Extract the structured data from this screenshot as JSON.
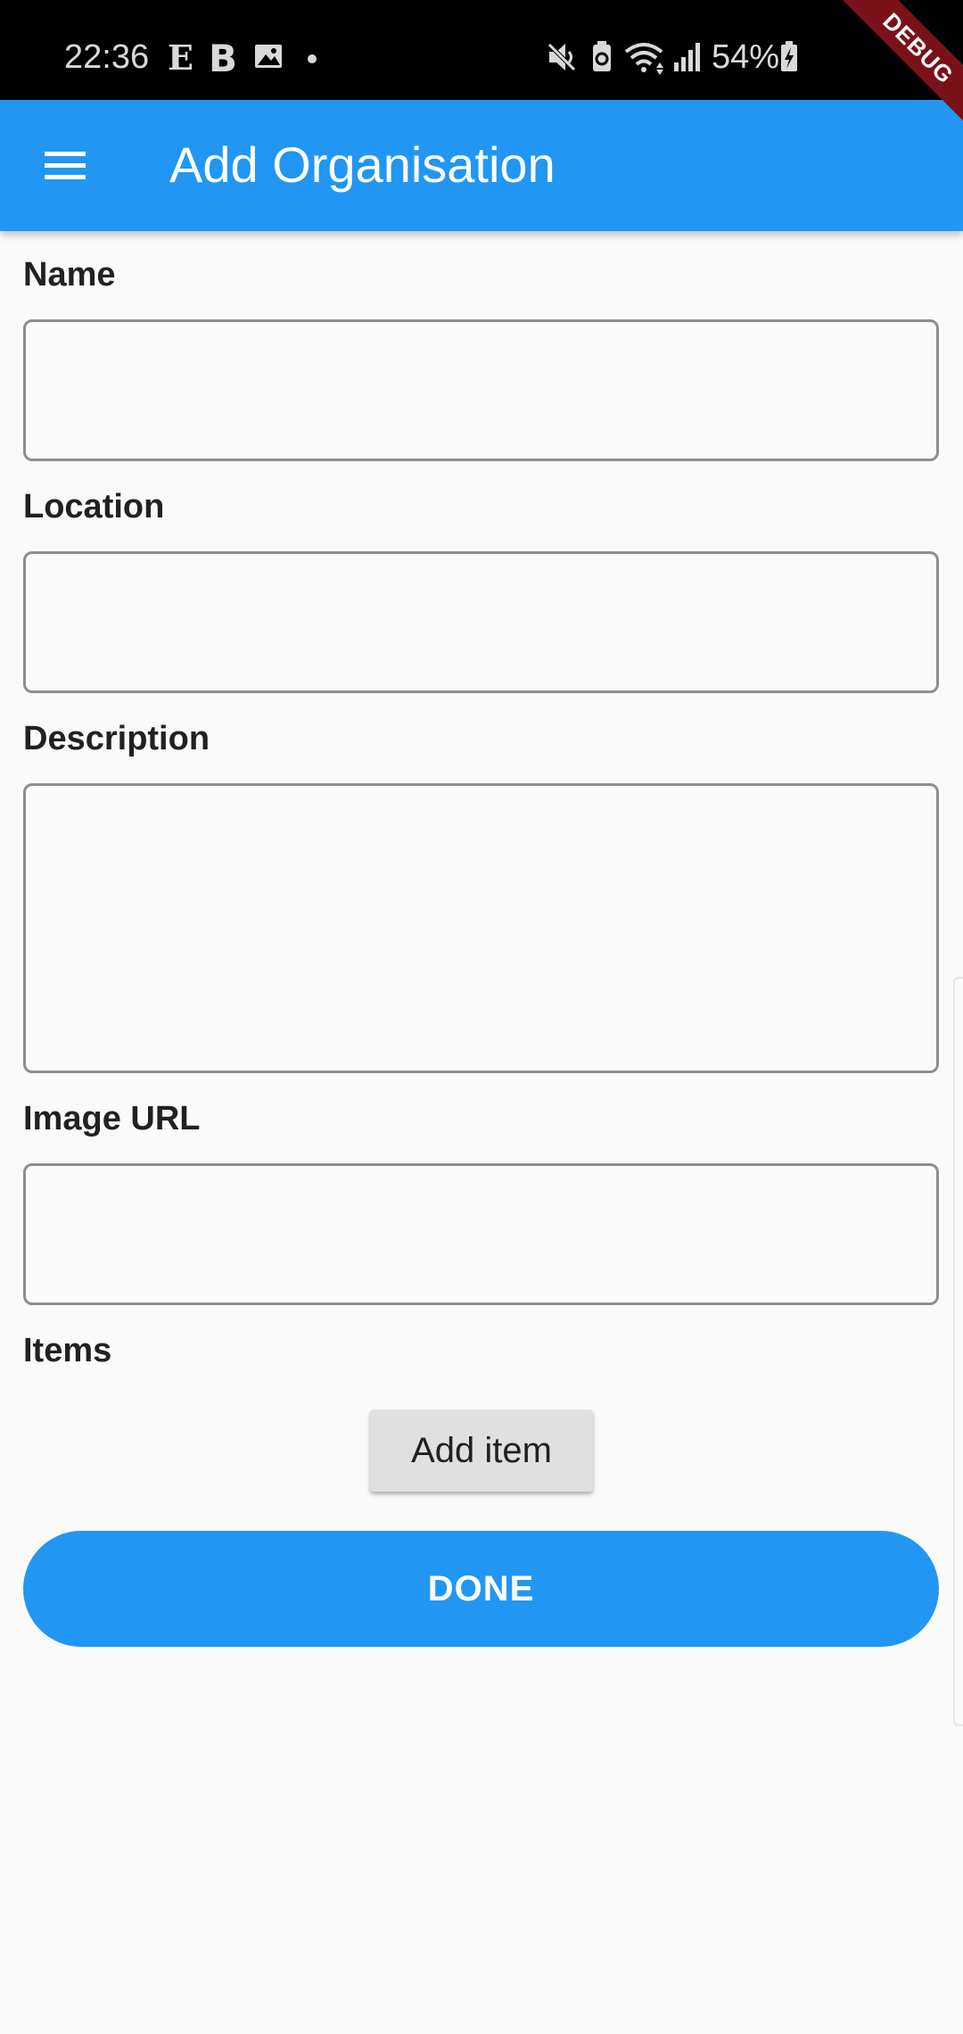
{
  "status_bar": {
    "time": "22:36",
    "battery": "54%",
    "notification_icons": [
      "e-letter-icon",
      "b-letter-icon",
      "image-icon",
      "dot-icon"
    ],
    "system_icons": [
      "mute-icon",
      "battery-saver-icon",
      "wifi-icon",
      "signal-icon",
      "battery-charging-icon"
    ]
  },
  "debug_banner": "DEBUG",
  "app_bar": {
    "title": "Add Organisation",
    "menu_icon": "hamburger-menu-icon",
    "color": "#2196f3"
  },
  "form": {
    "name": {
      "label": "Name",
      "value": "",
      "placeholder": ""
    },
    "location": {
      "label": "Location",
      "value": "",
      "placeholder": ""
    },
    "description": {
      "label": "Description",
      "value": "",
      "placeholder": ""
    },
    "image_url": {
      "label": "Image URL",
      "value": "",
      "placeholder": ""
    },
    "items": {
      "label": "Items",
      "add_button": "Add item"
    }
  },
  "done_button": "DONE",
  "colors": {
    "accent": "#2196f3",
    "debug": "#7a1119",
    "background": "#fafafa"
  }
}
